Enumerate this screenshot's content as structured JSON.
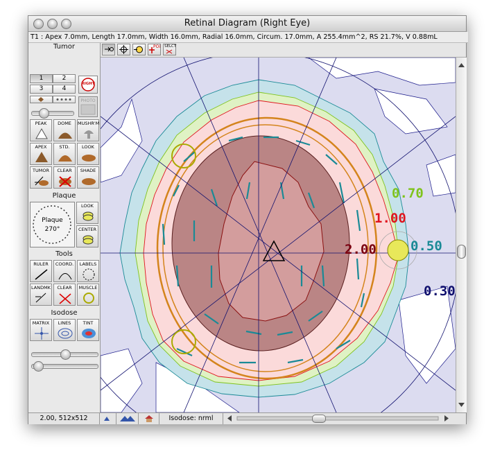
{
  "window": {
    "title": "Retinal Diagram (Right Eye)"
  },
  "info_line": "T1 : Apex 7.0mm, Length 17.0mm, Width 16.0mm, Radial 16.0mm, Circum. 17.0mm, A 255.4mm^2, RS 21.7%, V 0.88mL",
  "palette": {
    "tumor_title": "Tumor",
    "tumor_numbers": [
      "1",
      "2",
      "3",
      "4"
    ],
    "right_label": "RIGHT",
    "photo_label": "PHOTO",
    "tumor_tools": [
      {
        "label": "PEAK",
        "icon": "peak-icon"
      },
      {
        "label": "DOME",
        "icon": "dome-icon"
      },
      {
        "label": "MUSHR'M",
        "icon": "mushroom-icon"
      },
      {
        "label": "APEX",
        "icon": "apex-icon"
      },
      {
        "label": "STD.",
        "icon": "std-icon"
      },
      {
        "label": "LOOK",
        "icon": "look-icon"
      },
      {
        "label": "TUMOR",
        "icon": "tumor-icon"
      },
      {
        "label": "CLEAR",
        "icon": "clear-icon"
      },
      {
        "label": "SHADE",
        "icon": "shade-icon"
      }
    ],
    "plaque_title": "Plaque",
    "plaque_dial_label": "Plaque",
    "plaque_angle": "270°",
    "plaque_tools": [
      {
        "label": "LOOK",
        "icon": "plaque-look-icon"
      },
      {
        "label": "CENTER",
        "icon": "plaque-center-icon"
      }
    ],
    "tools_title": "Tools",
    "tools": [
      {
        "label": "RULER",
        "icon": "ruler-icon"
      },
      {
        "label": "COORD.",
        "icon": "coord-icon"
      },
      {
        "label": "LABELS",
        "icon": "labels-icon"
      },
      {
        "label": "LANDMK",
        "icon": "landmark-icon"
      },
      {
        "label": "CLEAR",
        "icon": "clear-tools-icon"
      },
      {
        "label": "MUSCLE",
        "icon": "muscle-icon"
      }
    ],
    "isodose_title": "Isodose",
    "isodose_tools": [
      {
        "label": "MATRIX",
        "icon": "matrix-icon"
      },
      {
        "label": "LINES",
        "icon": "lines-icon"
      },
      {
        "label": "TINT",
        "icon": "tint-icon"
      }
    ]
  },
  "toolbar": {
    "poi_label": "POI",
    "select_label": "SELCT"
  },
  "diagram": {
    "isodose_labels": [
      {
        "text": "0.70",
        "color": "#7fc31c"
      },
      {
        "text": "1.00",
        "color": "#e0141e"
      },
      {
        "text": "2.00",
        "color": "#7a0010"
      },
      {
        "text": "0.50",
        "color": "#1a8a96"
      },
      {
        "text": "0.30",
        "color": "#10106e"
      }
    ]
  },
  "status": {
    "zoom": "2.00, 512x512",
    "isodose": "Isodose: nrml"
  },
  "colors": {
    "tumor_fill": "#8f4d4d",
    "plaque": "#e8e85a",
    "orbit_ring": "#d4841c"
  }
}
